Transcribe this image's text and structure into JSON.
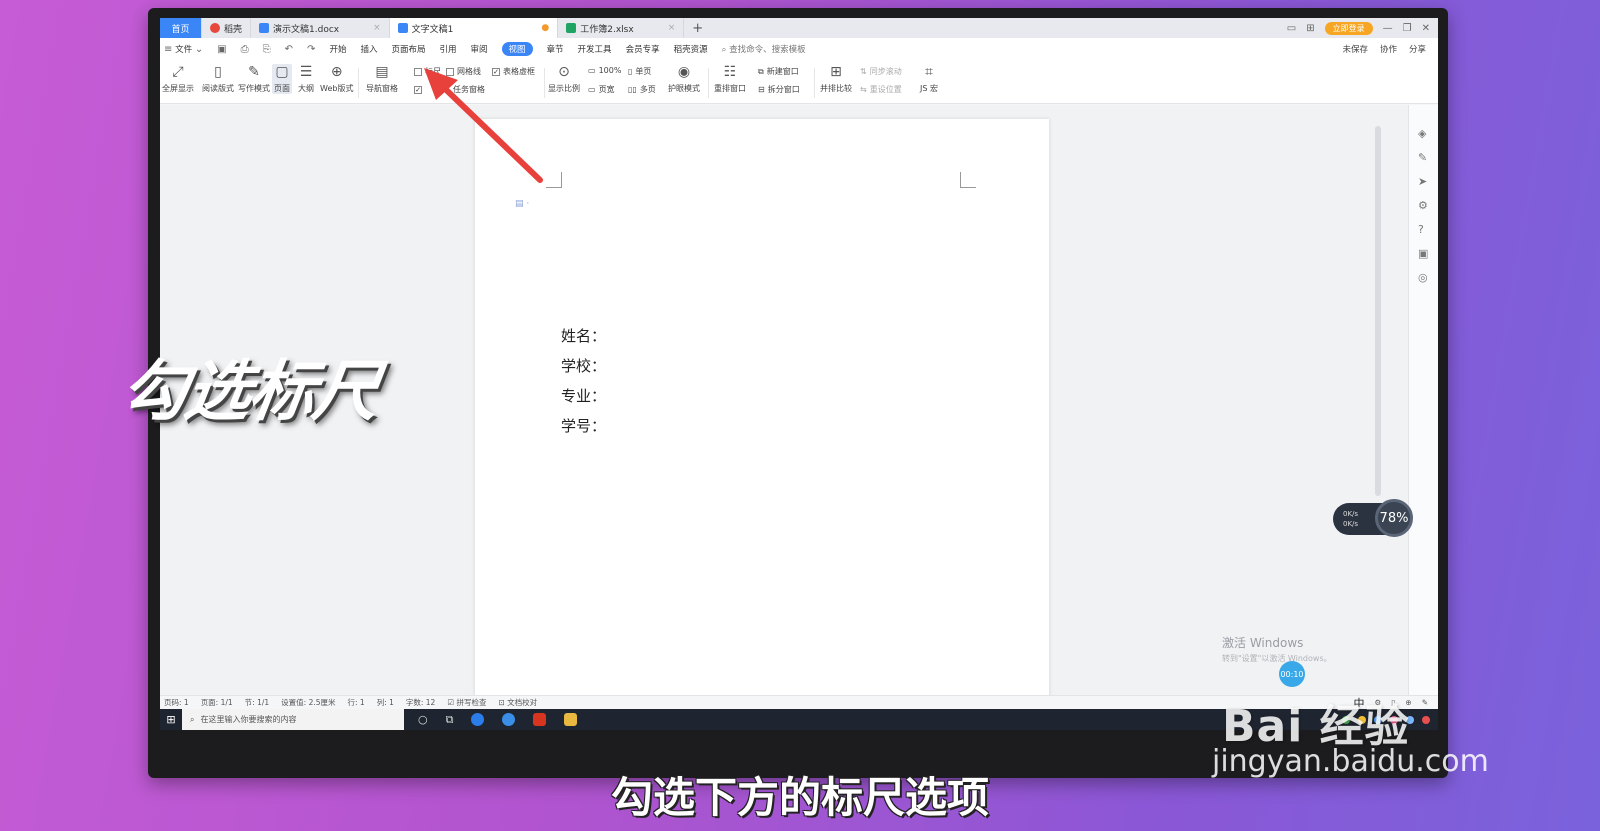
{
  "tabs": [
    {
      "label": "首页",
      "kind": "home"
    },
    {
      "label": "稻壳",
      "kind": "docer",
      "color": "#e8473c"
    },
    {
      "label": "演示文稿1.docx",
      "kind": "doc",
      "color": "#3a86f7"
    },
    {
      "label": "文字文稿1",
      "kind": "doc",
      "color": "#3a86f7",
      "active": true
    },
    {
      "label": "工作簿2.xlsx",
      "kind": "sheet",
      "color": "#1fa463"
    }
  ],
  "tabbar_right": {
    "login": "立即登录"
  },
  "menu": {
    "file": "文件",
    "items": [
      "开始",
      "插入",
      "页面布局",
      "引用",
      "审阅",
      "视图",
      "章节",
      "开发工具",
      "会员专享",
      "稻壳资源"
    ],
    "active": "视图",
    "search": "查找命令、搜索模板",
    "right": [
      "未保存",
      "协作",
      "分享"
    ]
  },
  "ribbon": {
    "fullscreen": "全屏显示",
    "reading": "阅读版式",
    "writing": "写作模式",
    "page": "页面",
    "outline": "大纲",
    "web": "Web版式",
    "nav": "导航窗格",
    "ruler": "标尺",
    "gridlines": "网格线",
    "table_border": "表格虚框",
    "taskpane": "任务窗格",
    "zoom_ratio": "显示比例",
    "zoom100": "100%",
    "page_width": "页宽",
    "single_page": "单页",
    "multi_page": "多页",
    "eye_mode": "护眼模式",
    "rearrange": "重排窗口",
    "new_window": "新建窗口",
    "split_window": "拆分窗口",
    "compare": "并排比较",
    "sync_scroll": "同步滚动",
    "reset_pos": "重设位置",
    "js_macro": "JS 宏"
  },
  "document": {
    "lines": [
      "姓名：",
      "学校：",
      "专业：",
      "学号："
    ]
  },
  "statusbar": {
    "pages": "页码: 1",
    "page_of": "页面: 1/1",
    "section": "节: 1/1",
    "position": "设置值: 2.5厘米",
    "row": "行: 1",
    "col": "列: 1",
    "wordcount": "字数: 12",
    "spell": "拼写检查",
    "proof": "文档校对",
    "ime": "中"
  },
  "taskbar": {
    "search_placeholder": "在这里输入你要搜索的内容"
  },
  "activate": {
    "title": "激活 Windows",
    "sub": "转到\"设置\"以激活 Windows。"
  },
  "speed": {
    "up": "0K/s",
    "down": "0K/s",
    "gauge": "78%"
  },
  "timer": "00:10",
  "overlay": {
    "caption": "勾选标尺",
    "subtitle": "勾选下方的标尺选项",
    "watermark_brand": "Bai 经验",
    "watermark_url": "jingyan.baidu.com"
  },
  "colors": {
    "accent": "#3a86f7",
    "arrow": "#e8403a",
    "login": "#f6a623"
  }
}
